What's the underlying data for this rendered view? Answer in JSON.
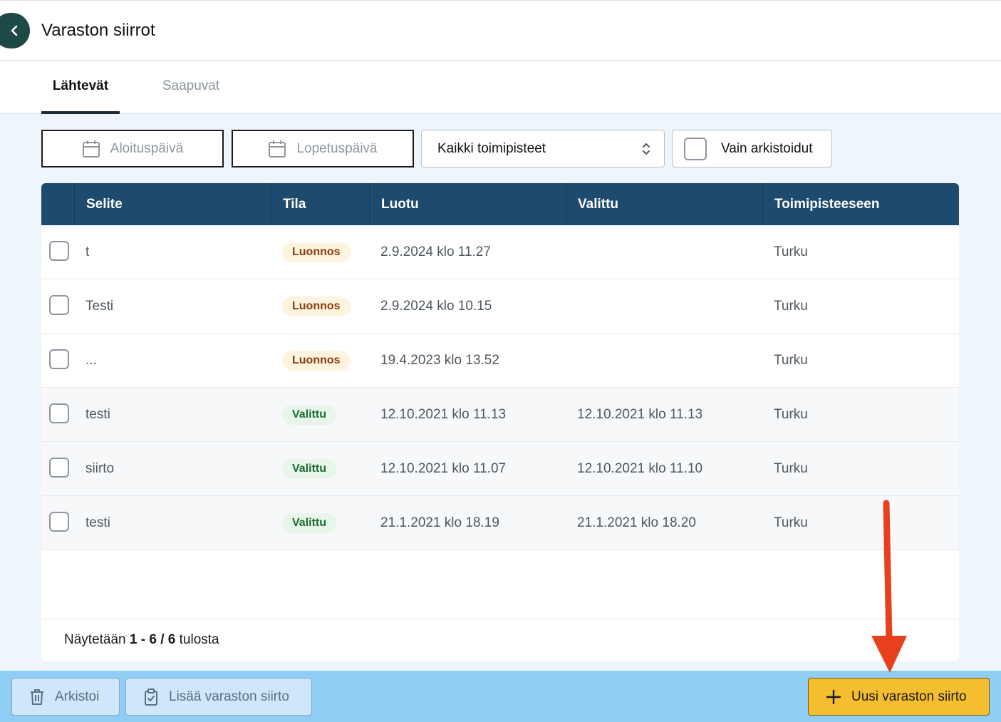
{
  "header": {
    "title": "Varaston siirrot"
  },
  "tabs": [
    {
      "label": "Lähtevät",
      "active": true
    },
    {
      "label": "Saapuvat",
      "active": false
    }
  ],
  "filters": {
    "start_date_placeholder": "Aloituspäivä",
    "end_date_placeholder": "Lopetuspäivä",
    "location_select_value": "Kaikki toimipisteet",
    "archived_only_label": "Vain arkistoidut"
  },
  "table": {
    "columns": [
      "Selite",
      "Tila",
      "Luotu",
      "Valittu",
      "Toimipisteeseen"
    ],
    "rows": [
      {
        "description": "t",
        "status": "Luonnos",
        "created": "2.9.2024 klo 11.27",
        "selected": "",
        "destination": "Turku"
      },
      {
        "description": "Testi",
        "status": "Luonnos",
        "created": "2.9.2024 klo 10.15",
        "selected": "",
        "destination": "Turku"
      },
      {
        "description": "...",
        "status": "Luonnos",
        "created": "19.4.2023 klo 13.52",
        "selected": "",
        "destination": "Turku"
      },
      {
        "description": "testi",
        "status": "Valittu",
        "created": "12.10.2021 klo 11.13",
        "selected": "12.10.2021 klo 11.13",
        "destination": "Turku"
      },
      {
        "description": "siirto",
        "status": "Valittu",
        "created": "12.10.2021 klo 11.07",
        "selected": "12.10.2021 klo 11.10",
        "destination": "Turku"
      },
      {
        "description": "testi",
        "status": "Valittu",
        "created": "21.1.2021 klo 18.19",
        "selected": "21.1.2021 klo 18.20",
        "destination": "Turku"
      }
    ],
    "footer": {
      "prefix": "Näytetään",
      "range": "1 - 6",
      "separator": "/",
      "total": "6",
      "suffix": "tulosta"
    }
  },
  "actions": {
    "archive_label": "Arkistoi",
    "add_transfer_label": "Lisää varaston siirto",
    "new_transfer_label": "Uusi varaston siirto"
  },
  "colors": {
    "header_bg": "#1e4a6d",
    "primary_button": "#f5bd30",
    "bottom_bar": "#8fcdf4",
    "annotation_arrow": "#e8401c"
  },
  "icons": {
    "back": "chevron-left-icon",
    "date": "calendar-icon",
    "select": "sort-arrows-icon",
    "archive": "trash-icon",
    "add": "clipboard-check-icon",
    "new": "plus-icon"
  }
}
